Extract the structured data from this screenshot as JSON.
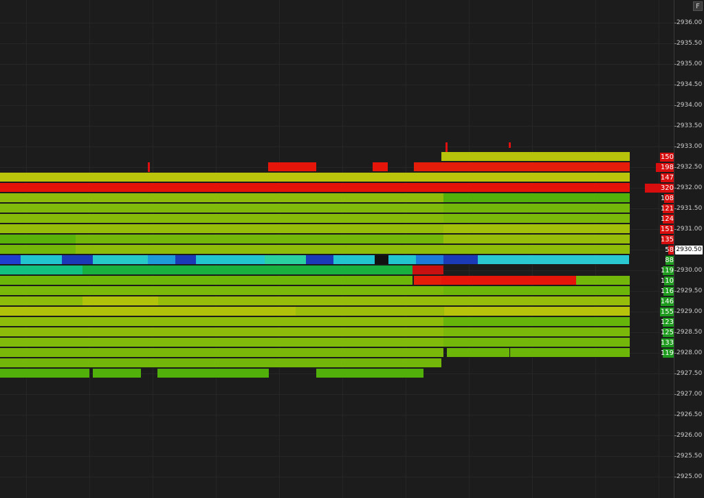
{
  "app": {
    "panel_button": "F"
  },
  "price_axis": {
    "ticks": [
      "2936.00",
      "2935.50",
      "2935.00",
      "2934.50",
      "2934.00",
      "2933.50",
      "2933.00",
      "2932.50",
      "2932.00",
      "2931.50",
      "2931.00",
      "2930.50",
      "2930.00",
      "2929.50",
      "2929.00",
      "2928.50",
      "2928.00",
      "2927.50",
      "2927.00",
      "2926.50",
      "2926.00",
      "2925.50",
      "2925.00"
    ],
    "current_price": "2930.50"
  },
  "colors": {
    "ask": "#d80e0e",
    "bid": "#1e9a1e",
    "background": "#1c1c1c",
    "current_price_bg": "#ffffff"
  },
  "order_book": [
    {
      "price": "2932.75",
      "size": "150",
      "side": "ask",
      "level": 0.47
    },
    {
      "price": "2932.50",
      "size": "198",
      "side": "ask",
      "level": 0.62
    },
    {
      "price": "2932.25",
      "size": "147",
      "side": "ask",
      "level": 0.46
    },
    {
      "price": "2932.00",
      "size": "320",
      "side": "ask",
      "level": 1.0
    },
    {
      "price": "2931.75",
      "size": "108",
      "side": "ask",
      "level": 0.34
    },
    {
      "price": "2931.50",
      "size": "121",
      "side": "ask",
      "level": 0.38
    },
    {
      "price": "2931.25",
      "size": "124",
      "side": "ask",
      "level": 0.39
    },
    {
      "price": "2931.00",
      "size": "151",
      "side": "ask",
      "level": 0.47
    },
    {
      "price": "2930.75",
      "size": "135",
      "side": "ask",
      "level": 0.42
    },
    {
      "price": "2930.50",
      "size": "58",
      "side": "ask",
      "level": 0.18
    },
    {
      "price": "2930.25",
      "size": "88",
      "side": "bid",
      "level": 0.28
    },
    {
      "price": "2930.00",
      "size": "119",
      "side": "bid",
      "level": 0.37
    },
    {
      "price": "2929.75",
      "size": "110",
      "side": "bid",
      "level": 0.34
    },
    {
      "price": "2929.50",
      "size": "116",
      "side": "bid",
      "level": 0.36
    },
    {
      "price": "2929.25",
      "size": "146",
      "side": "bid",
      "level": 0.46
    },
    {
      "price": "2929.00",
      "size": "155",
      "side": "bid",
      "level": 0.48
    },
    {
      "price": "2928.75",
      "size": "123",
      "side": "bid",
      "level": 0.38
    },
    {
      "price": "2928.50",
      "size": "125",
      "side": "bid",
      "level": 0.39
    },
    {
      "price": "2928.25",
      "size": "133",
      "side": "bid",
      "level": 0.42
    },
    {
      "price": "2928.00",
      "size": "119",
      "side": "bid",
      "level": 0.37
    }
  ]
}
